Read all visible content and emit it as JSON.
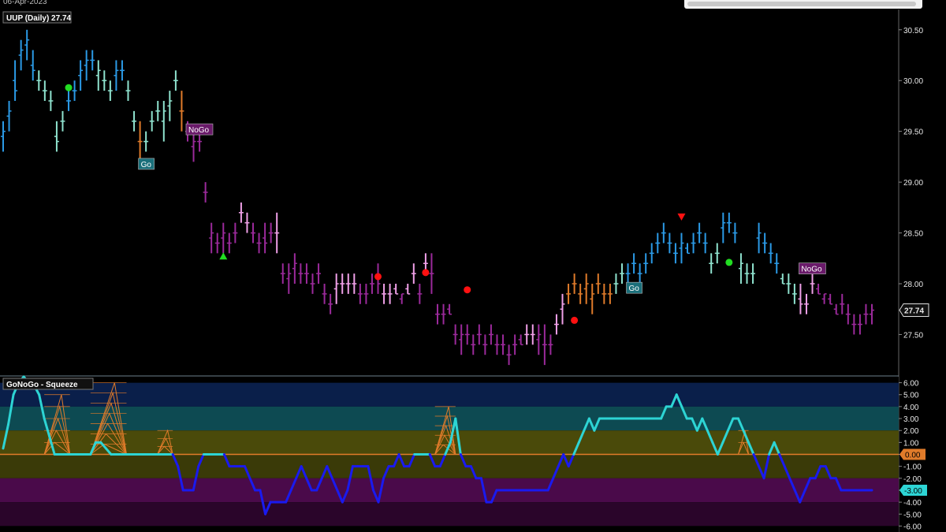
{
  "header": {
    "date": "06-Apr-2023"
  },
  "chart_data": [
    {
      "type": "bar",
      "title": "UUP (Daily) 27.74",
      "ylim": [
        27.1,
        30.7
      ],
      "yticks": [
        "30.50",
        "30.00",
        "29.50",
        "29.00",
        "28.50",
        "28.00",
        "27.50"
      ],
      "last_price": "27.74",
      "colors": {
        "strong_up": "#2b9ae6",
        "weak_up": "#8fe3cf",
        "neutral": "#e07b2a",
        "weak_down": "#f0a0e8",
        "strong_down": "#9b2a9b"
      },
      "bars": [
        [
          29.6,
          29.3,
          29.5,
          "strong_up"
        ],
        [
          29.8,
          29.5,
          29.7,
          "strong_up"
        ],
        [
          30.2,
          29.8,
          29.9,
          "strong_up"
        ],
        [
          30.4,
          30.1,
          30.3,
          "strong_up"
        ],
        [
          30.5,
          30.2,
          30.4,
          "strong_up"
        ],
        [
          30.3,
          30.0,
          30.1,
          "strong_up"
        ],
        [
          30.1,
          29.9,
          30.0,
          "weak_up"
        ],
        [
          30.0,
          29.8,
          29.9,
          "weak_up"
        ],
        [
          29.9,
          29.7,
          29.8,
          "weak_up"
        ],
        [
          29.6,
          29.3,
          29.4,
          "weak_up"
        ],
        [
          29.7,
          29.5,
          29.6,
          "weak_up"
        ],
        [
          29.9,
          29.7,
          29.8,
          "strong_up"
        ],
        [
          30.0,
          29.8,
          29.9,
          "strong_up"
        ],
        [
          30.2,
          29.9,
          30.1,
          "strong_up"
        ],
        [
          30.3,
          30.0,
          30.2,
          "strong_up"
        ],
        [
          30.3,
          30.1,
          30.2,
          "strong_up"
        ],
        [
          30.2,
          29.9,
          30.1,
          "weak_up"
        ],
        [
          30.1,
          29.9,
          30.0,
          "weak_up"
        ],
        [
          30.0,
          29.8,
          29.9,
          "weak_up"
        ],
        [
          30.2,
          29.9,
          30.1,
          "strong_up"
        ],
        [
          30.2,
          30.0,
          30.1,
          "strong_up"
        ],
        [
          30.0,
          29.8,
          29.9,
          "weak_up"
        ],
        [
          29.7,
          29.5,
          29.6,
          "weak_up"
        ],
        [
          29.6,
          29.2,
          29.4,
          "neutral"
        ],
        [
          29.5,
          29.3,
          29.4,
          "weak_up"
        ],
        [
          29.7,
          29.5,
          29.6,
          "weak_up"
        ],
        [
          29.8,
          29.6,
          29.7,
          "weak_up"
        ],
        [
          29.8,
          29.4,
          29.7,
          "weak_up"
        ],
        [
          29.9,
          29.6,
          29.8,
          "weak_up"
        ],
        [
          30.1,
          29.9,
          30.0,
          "weak_up"
        ],
        [
          29.9,
          29.5,
          29.7,
          "neutral"
        ],
        [
          29.6,
          29.4,
          29.5,
          "strong_down"
        ],
        [
          29.5,
          29.2,
          29.4,
          "strong_down"
        ],
        [
          29.5,
          29.3,
          29.4,
          "strong_down"
        ],
        [
          29.0,
          28.8,
          28.9,
          "strong_down"
        ],
        [
          28.6,
          28.3,
          28.5,
          "strong_down"
        ],
        [
          28.5,
          28.3,
          28.4,
          "strong_down"
        ],
        [
          28.6,
          28.3,
          28.5,
          "strong_down"
        ],
        [
          28.5,
          28.3,
          28.4,
          "strong_down"
        ],
        [
          28.6,
          28.4,
          28.5,
          "strong_down"
        ],
        [
          28.8,
          28.6,
          28.7,
          "weak_down"
        ],
        [
          28.7,
          28.5,
          28.6,
          "weak_down"
        ],
        [
          28.6,
          28.4,
          28.5,
          "strong_down"
        ],
        [
          28.5,
          28.3,
          28.4,
          "strong_down"
        ],
        [
          28.6,
          28.3,
          28.4,
          "strong_down"
        ],
        [
          28.6,
          28.4,
          28.5,
          "strong_down"
        ],
        [
          28.7,
          28.3,
          28.5,
          "weak_down"
        ],
        [
          28.2,
          28.0,
          28.1,
          "strong_down"
        ],
        [
          28.2,
          27.9,
          28.1,
          "strong_down"
        ],
        [
          28.3,
          28.0,
          28.2,
          "strong_down"
        ],
        [
          28.2,
          28.0,
          28.1,
          "strong_down"
        ],
        [
          28.2,
          28.0,
          28.1,
          "strong_down"
        ],
        [
          28.1,
          27.9,
          28.0,
          "strong_down"
        ],
        [
          28.2,
          28.0,
          28.1,
          "strong_down"
        ],
        [
          28.0,
          27.8,
          27.9,
          "strong_down"
        ],
        [
          27.9,
          27.7,
          27.8,
          "strong_down"
        ],
        [
          28.1,
          27.8,
          28.0,
          "weak_down"
        ],
        [
          28.1,
          27.9,
          28.0,
          "weak_down"
        ],
        [
          28.1,
          27.9,
          28.0,
          "weak_down"
        ],
        [
          28.1,
          27.9,
          28.0,
          "weak_down"
        ],
        [
          28.0,
          27.8,
          27.9,
          "strong_down"
        ],
        [
          28.0,
          27.8,
          27.9,
          "strong_down"
        ],
        [
          28.1,
          27.9,
          28.0,
          "strong_down"
        ],
        [
          28.2,
          27.9,
          28.0,
          "strong_down"
        ],
        [
          28.0,
          27.8,
          27.9,
          "weak_down"
        ],
        [
          28.0,
          27.8,
          27.9,
          "weak_down"
        ],
        [
          28.0,
          27.9,
          27.9,
          "weak_down"
        ],
        [
          27.9,
          27.8,
          27.9,
          "strong_down"
        ],
        [
          28.0,
          27.9,
          27.9,
          "weak_down"
        ],
        [
          28.2,
          28.0,
          28.1,
          "weak_down"
        ],
        [
          28.0,
          27.8,
          27.9,
          "strong_down"
        ],
        [
          28.3,
          28.1,
          28.2,
          "weak_down"
        ],
        [
          28.3,
          27.9,
          28.1,
          "strong_down"
        ],
        [
          27.8,
          27.6,
          27.7,
          "strong_down"
        ],
        [
          27.8,
          27.6,
          27.7,
          "strong_down"
        ],
        [
          27.8,
          27.7,
          27.7,
          "strong_down"
        ],
        [
          27.6,
          27.4,
          27.5,
          "strong_down"
        ],
        [
          27.6,
          27.3,
          27.5,
          "strong_down"
        ],
        [
          27.6,
          27.4,
          27.5,
          "strong_down"
        ],
        [
          27.5,
          27.3,
          27.4,
          "strong_down"
        ],
        [
          27.6,
          27.4,
          27.5,
          "strong_down"
        ],
        [
          27.5,
          27.3,
          27.4,
          "strong_down"
        ],
        [
          27.6,
          27.4,
          27.5,
          "strong_down"
        ],
        [
          27.5,
          27.3,
          27.4,
          "strong_down"
        ],
        [
          27.5,
          27.3,
          27.4,
          "strong_down"
        ],
        [
          27.4,
          27.2,
          27.3,
          "strong_down"
        ],
        [
          27.5,
          27.3,
          27.4,
          "strong_down"
        ],
        [
          27.5,
          27.4,
          27.4,
          "strong_down"
        ],
        [
          27.6,
          27.4,
          27.5,
          "weak_down"
        ],
        [
          27.6,
          27.4,
          27.5,
          "weak_down"
        ],
        [
          27.6,
          27.3,
          27.5,
          "strong_down"
        ],
        [
          27.6,
          27.2,
          27.4,
          "strong_down"
        ],
        [
          27.5,
          27.3,
          27.4,
          "strong_down"
        ],
        [
          27.7,
          27.5,
          27.6,
          "weak_down"
        ],
        [
          27.9,
          27.6,
          27.8,
          "weak_down"
        ],
        [
          28.0,
          27.8,
          27.9,
          "neutral"
        ],
        [
          28.1,
          27.9,
          28.0,
          "neutral"
        ],
        [
          28.0,
          27.8,
          27.9,
          "neutral"
        ],
        [
          28.1,
          27.8,
          28.0,
          "neutral"
        ],
        [
          28.0,
          27.7,
          27.9,
          "neutral"
        ],
        [
          28.1,
          27.9,
          28.0,
          "neutral"
        ],
        [
          28.0,
          27.8,
          27.9,
          "neutral"
        ],
        [
          28.0,
          27.8,
          27.9,
          "neutral"
        ],
        [
          28.1,
          27.9,
          28.0,
          "weak_up"
        ],
        [
          28.2,
          28.0,
          28.1,
          "weak_up"
        ],
        [
          28.2,
          28.0,
          28.1,
          "strong_up"
        ],
        [
          28.3,
          28.1,
          28.2,
          "strong_up"
        ],
        [
          28.2,
          28.0,
          28.1,
          "strong_up"
        ],
        [
          28.3,
          28.1,
          28.2,
          "strong_up"
        ],
        [
          28.4,
          28.2,
          28.3,
          "strong_up"
        ],
        [
          28.5,
          28.3,
          28.4,
          "strong_up"
        ],
        [
          28.6,
          28.4,
          28.5,
          "strong_up"
        ],
        [
          28.5,
          28.3,
          28.4,
          "strong_up"
        ],
        [
          28.4,
          28.2,
          28.3,
          "strong_up"
        ],
        [
          28.5,
          28.2,
          28.4,
          "strong_up"
        ],
        [
          28.4,
          28.3,
          28.3,
          "strong_up"
        ],
        [
          28.5,
          28.3,
          28.4,
          "strong_up"
        ],
        [
          28.6,
          28.4,
          28.5,
          "strong_up"
        ],
        [
          28.5,
          28.3,
          28.4,
          "strong_up"
        ],
        [
          28.3,
          28.1,
          28.2,
          "weak_up"
        ],
        [
          28.4,
          28.2,
          28.3,
          "weak_up"
        ],
        [
          28.7,
          28.4,
          28.6,
          "strong_up"
        ],
        [
          28.7,
          28.5,
          28.6,
          "strong_up"
        ],
        [
          28.6,
          28.4,
          28.5,
          "strong_up"
        ],
        [
          28.3,
          28.0,
          28.2,
          "weak_up"
        ],
        [
          28.2,
          28.0,
          28.1,
          "weak_up"
        ],
        [
          28.2,
          28.0,
          28.1,
          "weak_up"
        ],
        [
          28.6,
          28.3,
          28.5,
          "strong_up"
        ],
        [
          28.5,
          28.3,
          28.4,
          "strong_up"
        ],
        [
          28.4,
          28.2,
          28.3,
          "strong_up"
        ],
        [
          28.3,
          28.1,
          28.2,
          "strong_up"
        ],
        [
          28.1,
          28.0,
          28.0,
          "weak_up"
        ],
        [
          28.1,
          27.9,
          28.0,
          "weak_up"
        ],
        [
          28.0,
          27.8,
          27.9,
          "weak_up"
        ],
        [
          28.0,
          27.7,
          27.8,
          "weak_down"
        ],
        [
          27.9,
          27.7,
          27.8,
          "weak_down"
        ],
        [
          28.1,
          27.9,
          28.0,
          "weak_down"
        ],
        [
          28.0,
          27.9,
          27.9,
          "strong_down"
        ],
        [
          27.9,
          27.8,
          27.9,
          "strong_down"
        ],
        [
          27.9,
          27.8,
          27.8,
          "strong_down"
        ],
        [
          27.8,
          27.7,
          27.7,
          "strong_down"
        ],
        [
          27.9,
          27.7,
          27.8,
          "strong_down"
        ],
        [
          27.8,
          27.6,
          27.7,
          "strong_down"
        ],
        [
          27.7,
          27.5,
          27.6,
          "strong_down"
        ],
        [
          27.7,
          27.5,
          27.6,
          "strong_down"
        ],
        [
          27.8,
          27.6,
          27.7,
          "strong_down"
        ],
        [
          27.8,
          27.6,
          27.74,
          "strong_down"
        ]
      ],
      "annotations": [
        {
          "text": "Go",
          "at_bar": 23,
          "price": 29.18,
          "kind": "go"
        },
        {
          "text": "NoGo",
          "at_bar": 31,
          "price": 29.52,
          "kind": "nogo"
        },
        {
          "text": "Go",
          "at_bar": 105,
          "price": 27.96,
          "kind": "go"
        },
        {
          "text": "NoGo",
          "at_bar": 134,
          "price": 28.15,
          "kind": "nogo"
        }
      ],
      "markers": [
        {
          "shape": "circle",
          "color": "#22dd22",
          "at_bar": 11,
          "price": 29.93
        },
        {
          "shape": "triangle-up",
          "color": "#22dd22",
          "at_bar": 37,
          "price": 28.27
        },
        {
          "shape": "circle",
          "color": "#ff1111",
          "at_bar": 63,
          "price": 28.07
        },
        {
          "shape": "circle",
          "color": "#ff1111",
          "at_bar": 71,
          "price": 28.11
        },
        {
          "shape": "circle",
          "color": "#ff1111",
          "at_bar": 78,
          "price": 27.94
        },
        {
          "shape": "circle",
          "color": "#ff1111",
          "at_bar": 96,
          "price": 27.64
        },
        {
          "shape": "triangle-down",
          "color": "#ff1111",
          "at_bar": 114,
          "price": 28.66
        },
        {
          "shape": "circle",
          "color": "#22dd22",
          "at_bar": 122,
          "price": 28.21
        }
      ]
    },
    {
      "type": "line",
      "title": "GoNoGo - Squeeze",
      "ylim": [
        -6.5,
        6.5
      ],
      "yticks": [
        "6.00",
        "5.00",
        "4.00",
        "3.00",
        "2.00",
        "1.00",
        "0.00",
        "-1.00",
        "-2.00",
        "-3.00",
        "-4.00",
        "-5.00",
        "-6.00"
      ],
      "zero_label": "0.00",
      "last_value_label": "-3.00",
      "zones": [
        {
          "from": 4,
          "to": 6,
          "color": "#0a1f4a"
        },
        {
          "from": 2,
          "to": 4,
          "color": "#0d4a52"
        },
        {
          "from": 0,
          "to": 2,
          "color": "#4a4a0a"
        },
        {
          "from": -2,
          "to": 0,
          "color": "#3a3a08"
        },
        {
          "from": -4,
          "to": -2,
          "color": "#4a0a4a"
        },
        {
          "from": -6,
          "to": -4,
          "color": "#2a052a"
        }
      ],
      "values": [
        0.5,
        2.5,
        5,
        6,
        6.5,
        6,
        5.8,
        5,
        3,
        1.5,
        0,
        0,
        0,
        0,
        0,
        0,
        0,
        0,
        1,
        1,
        0.5,
        0,
        0,
        0,
        0,
        0,
        0,
        0,
        0,
        0,
        0,
        0,
        0,
        0,
        -1,
        -3,
        -3,
        -3,
        -1,
        0,
        0,
        0,
        0,
        0,
        -1,
        -1,
        -1,
        -1,
        -2,
        -3,
        -3,
        -5,
        -4,
        -4,
        -4,
        -4,
        -3,
        -2,
        -1,
        -2,
        -3,
        -3,
        -2,
        -1,
        -2,
        -3,
        -4,
        -3,
        -1,
        -1,
        -1,
        -1,
        -3,
        -4,
        -2,
        -1,
        -1,
        0,
        -1,
        -1,
        0,
        0,
        0,
        0,
        -1,
        -1,
        0,
        1,
        3,
        0,
        -1,
        -1,
        -2,
        -2,
        -4,
        -4,
        -3,
        -3,
        -3,
        -3,
        -3,
        -3,
        -3,
        -3,
        -3,
        -3,
        -3,
        -2,
        -1,
        0,
        -1,
        0,
        1,
        2,
        3,
        2,
        3,
        3,
        3,
        3,
        3,
        3,
        3,
        3,
        3,
        3,
        3,
        3,
        3,
        4,
        4,
        5,
        4,
        3,
        3,
        2,
        3,
        2,
        1,
        0,
        1,
        2,
        3,
        3,
        2,
        1,
        0,
        -1,
        -2,
        0,
        1,
        0,
        -1,
        -2,
        -3,
        -4,
        -3,
        -2,
        -2,
        -1,
        -1,
        -2,
        -2,
        -3,
        -3,
        -3,
        -3,
        -3,
        -3,
        -3
      ],
      "line_colors": {
        "positive": "#2dd4d4",
        "negative": "#1a1aee"
      },
      "squeeze_peaks": [
        {
          "start": 8,
          "end": 13,
          "levels": 5,
          "height": 5
        },
        {
          "start": 17,
          "end": 24,
          "levels": 7,
          "height": 6
        },
        {
          "start": 30,
          "end": 33,
          "levels": 3,
          "height": 2
        },
        {
          "start": 84,
          "end": 88,
          "levels": 5,
          "height": 4
        },
        {
          "start": 143,
          "end": 145,
          "levels": 2,
          "height": 2
        }
      ]
    }
  ]
}
